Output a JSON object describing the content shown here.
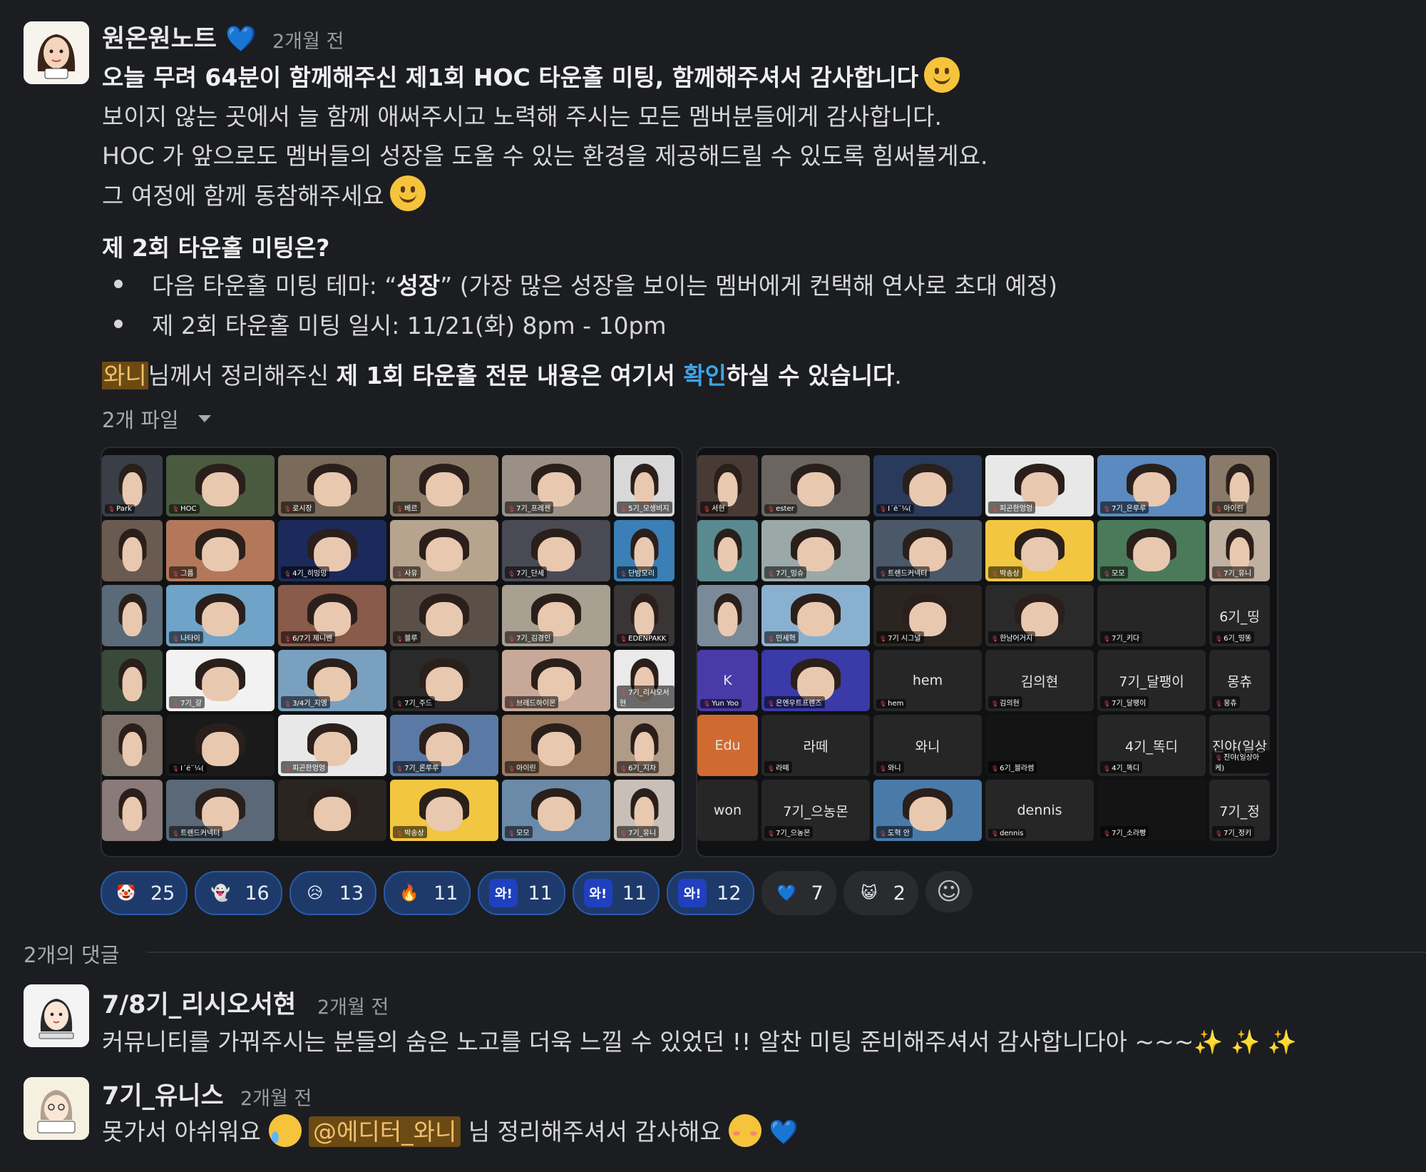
{
  "post": {
    "author": "원온원노트",
    "author_badge": "💙",
    "time": "2개월 전",
    "headline": "오늘 무려 64분이 함께해주신 제1회 HOC 타운홀 미팅, 함께해주셔서 감사합니다",
    "line2": "보이지 않는 곳에서 늘 함께 애써주시고 노력해 주시는 모든 멤버분들에게 감사합니다.",
    "line3": "HOC 가 앞으로도 멤버들의 성장을 도울 수 있는 환경을 제공해드릴 수 있도록 힘써볼게요.",
    "line4": "그 여정에 함께 동참해주세요",
    "section_title": "제 2회 타운홀 미팅은?",
    "bullet1_prefix": "다음 타운홀 미팅 테마: “",
    "bullet1_bold": "성장",
    "bullet1_suffix": "” (가장 많은 성장을 보이는 멤버에게 컨택해 연사로 초대 예정)",
    "bullet2": "제 2회 타운홀 미팅 일시: 11/21(화) 8pm - 10pm",
    "summary_mention": "와니",
    "summary_mid": "님께서 정리해주신 ",
    "summary_bold1": "제 1회 타운홀 전문 내용은 여기서 ",
    "summary_link": "확인",
    "summary_bold2": "하실 수 있습니다",
    "summary_end": ".",
    "files_label": "2개 파일"
  },
  "screenshot_left": {
    "tiles": [
      {
        "label": "Park",
        "bg": "#3a3f47"
      },
      {
        "label": "HOC",
        "bg": "#4a5a3f"
      },
      {
        "label": "로시장",
        "bg": "#7a6a5a"
      },
      {
        "label": "베르",
        "bg": "#8a7a68"
      },
      {
        "label": "7기_프레젠",
        "bg": "#9a9085"
      },
      {
        "label": "5기_모생비지",
        "bg": "#d8d8d8"
      },
      {
        "label": "",
        "bg": "#6a5a50"
      },
      {
        "label": "그룹",
        "bg": "#b3785a"
      },
      {
        "label": "4기_히밍밍",
        "bg": "#1b2a5a"
      },
      {
        "label": "사유",
        "bg": "#b7a48e"
      },
      {
        "label": "7기_단세",
        "bg": "#4a4a55"
      },
      {
        "label": "단밤모리",
        "bg": "#3a7fb5"
      },
      {
        "label": "",
        "bg": "#5a6a78"
      },
      {
        "label": "나타이",
        "bg": "#6fa3c8"
      },
      {
        "label": "6/7기 제니벤",
        "bg": "#8a5a4a"
      },
      {
        "label": "블루",
        "bg": "#5a5048"
      },
      {
        "label": "7기_김경인",
        "bg": "#a8a090"
      },
      {
        "label": "EDENPAKK",
        "bg": "#3a3535"
      },
      {
        "label": "",
        "bg": "#3a4a3a"
      },
      {
        "label": "7기_갈",
        "bg": "#f2f2f2"
      },
      {
        "label": "3/4기_지엥",
        "bg": "#7aa0c0"
      },
      {
        "label": "7기_주드",
        "bg": "#2a2a2a"
      },
      {
        "label": "브레드하이몬",
        "bg": "#c8a898"
      },
      {
        "label": "7기_리시오서현",
        "bg": "#eaeaea"
      },
      {
        "label": "",
        "bg": "#7a7068"
      },
      {
        "label": "I´ё¨¼(",
        "bg": "#1a1a1a"
      },
      {
        "label": "피곤한엉엉",
        "bg": "#e8e8e8"
      },
      {
        "label": "7기_론루루",
        "bg": "#5a7aa5"
      },
      {
        "label": "아이린",
        "bg": "#9a7a60"
      },
      {
        "label": "6기_지차",
        "bg": "#b09a88"
      },
      {
        "label": "",
        "bg": "#8a7a78"
      },
      {
        "label": "트렌드커넥터",
        "bg": "#5a6878"
      },
      {
        "label": "",
        "bg": "#2a2520"
      },
      {
        "label": "박송상",
        "bg": "#f2c640"
      },
      {
        "label": "모모",
        "bg": "#6a8aa8"
      },
      {
        "label": "7기_유니",
        "bg": "#c8c0b8"
      }
    ]
  },
  "screenshot_right": {
    "tiles": [
      {
        "label": "서현",
        "bg": "#4a3a35"
      },
      {
        "label": "ester",
        "bg": "#6a6560"
      },
      {
        "label": "I´ё¨¼(",
        "bg": "#2a3a5a"
      },
      {
        "label": "피곤한엉엉",
        "bg": "#e8e8e8"
      },
      {
        "label": "7기_은루루",
        "bg": "#5a8ac0"
      },
      {
        "label": "아이린",
        "bg": "#8a7a68"
      },
      {
        "label": "",
        "bg": "#5a8a90"
      },
      {
        "label": "7기_밍슈",
        "bg": "#9aa8a8"
      },
      {
        "label": "트렌드커넥터",
        "bg": "#4a5868"
      },
      {
        "label": "박송상",
        "bg": "#f2c640"
      },
      {
        "label": "모모",
        "bg": "#4a7a5a"
      },
      {
        "label": "7기_유니",
        "bg": "#c0b0a0"
      },
      {
        "label": "",
        "bg": "#7a8a98"
      },
      {
        "label": "민세혁",
        "bg": "#8ab0d0"
      },
      {
        "label": "7기 시그널",
        "bg": "#2a2520"
      },
      {
        "label": "한남어거지",
        "bg": "#2a2a2a"
      },
      {
        "label": "7기_키다",
        "bg": "#262626",
        "name": ""
      },
      {
        "label": "6기_띵똥",
        "bg": "#262626",
        "name": "6기_띵"
      },
      {
        "label": "Yun Yoo",
        "bg": "#4a3aa8",
        "name": "K"
      },
      {
        "label": "은엔우트프렌즈",
        "bg": "#3a3aa8"
      },
      {
        "label": "hem",
        "bg": "#262626",
        "name": "hem"
      },
      {
        "label": "김의현",
        "bg": "#262626",
        "name": "김의현"
      },
      {
        "label": "7기_달팽이",
        "bg": "#262626",
        "name": "7기_달팽이"
      },
      {
        "label": "몽츄",
        "bg": "#262626",
        "name": "몽츄"
      },
      {
        "label": "",
        "bg": "#d06a30",
        "name": "Edu"
      },
      {
        "label": "라떼",
        "bg": "#262626",
        "name": "라떼"
      },
      {
        "label": "와니",
        "bg": "#262626",
        "name": "와니"
      },
      {
        "label": "6기_블라썸",
        "bg": "#141414"
      },
      {
        "label": "4기_똑디",
        "bg": "#262626",
        "name": "4기_똑디"
      },
      {
        "label": "진야(일상아케)",
        "bg": "#262626",
        "name": "진야(일상"
      },
      {
        "label": "",
        "bg": "#262626",
        "name": "won"
      },
      {
        "label": "7기_으농몬",
        "bg": "#262626",
        "name": "7기_으농몬"
      },
      {
        "label": "도혁 안",
        "bg": "#4a7aa8"
      },
      {
        "label": "dennis",
        "bg": "#262626",
        "name": "dennis"
      },
      {
        "label": "7기_소라빵",
        "bg": "#141414"
      },
      {
        "label": "7기_정키",
        "bg": "#262626",
        "name": "7기_정"
      }
    ]
  },
  "reactions": [
    {
      "icon": "face-paint-icon",
      "glyph": "🤡",
      "count": "25",
      "style": "active"
    },
    {
      "icon": "ghost-face-icon",
      "glyph": "👻",
      "count": "16",
      "style": "active"
    },
    {
      "icon": "cloud-face-icon",
      "glyph": "😥",
      "count": "13",
      "style": "active"
    },
    {
      "icon": "fire-icon",
      "glyph": "🔥",
      "count": "11",
      "style": "active"
    },
    {
      "icon": "wa-text-icon",
      "glyph": "와!",
      "count": "11",
      "style": "active"
    },
    {
      "icon": "wa-text-faded-icon",
      "glyph": "와!",
      "count": "11",
      "style": "active"
    },
    {
      "icon": "wa-text-blue-icon",
      "glyph": "와!",
      "count": "12",
      "style": "active"
    },
    {
      "icon": "blue-heart-icon",
      "glyph": "💙",
      "count": "7",
      "style": "plain"
    },
    {
      "icon": "character-icon",
      "glyph": "😺",
      "count": "2",
      "style": "plain"
    }
  ],
  "comments_label": "2개의 댓글",
  "comments": [
    {
      "author": "7/8기_리시오서현",
      "time": "2개월 전",
      "text": "커뮤니티를 가꿔주시는 분들의 숨은 노고를 더욱 느낄 수 있었던 !! 알찬 미팅 준비해주셔서 감사합니다아 ~~~",
      "sparkles": "✨ ✨ ✨"
    },
    {
      "author": "7기_유니스",
      "time": "2개월 전",
      "text_before": "못가서 아쉬워요",
      "mention": "@에디터_와니",
      "text_after": "님 정리해주셔서 감사해요",
      "heart": "💙"
    }
  ],
  "colors": {
    "background": "#1b1d21",
    "link": "#3ea3e6",
    "mention_bg": "#6b4a14",
    "mention_fg": "#f2c06a",
    "reaction_active": "#1d3a6b"
  }
}
